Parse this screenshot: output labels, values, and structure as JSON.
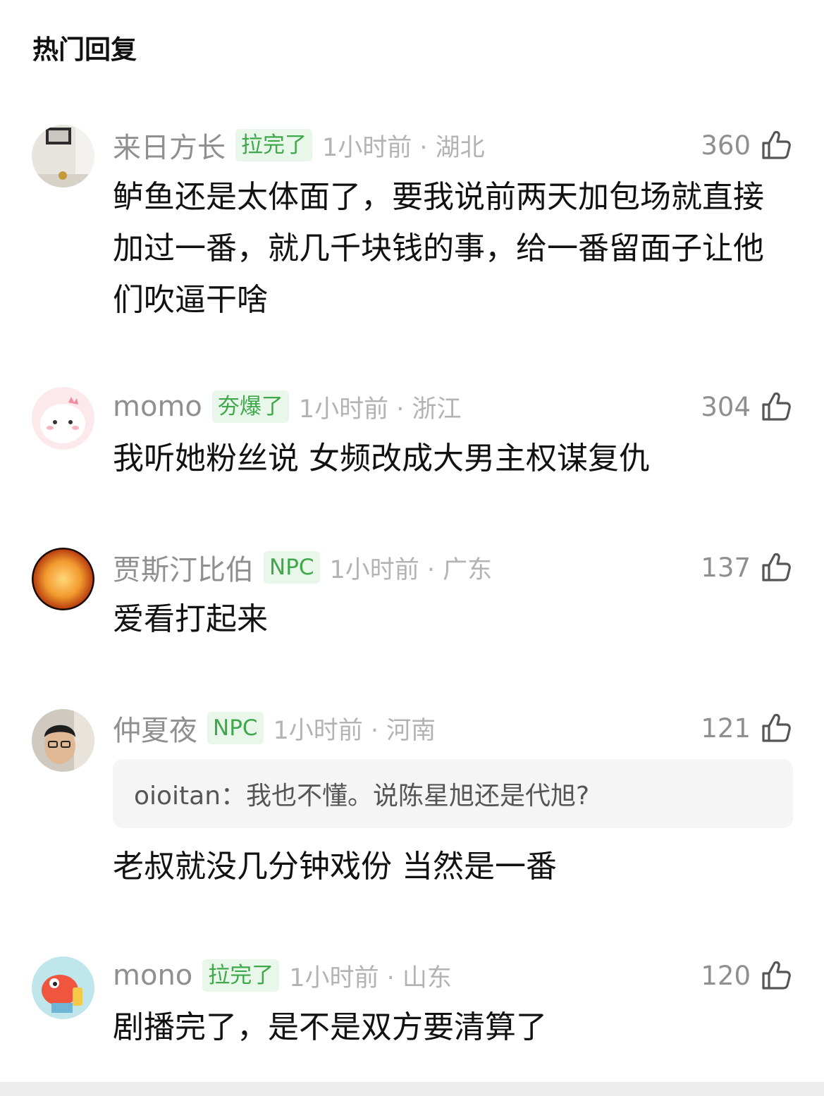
{
  "header": {
    "title": "热门回复"
  },
  "comments": [
    {
      "name": "来日方长",
      "badge": "拉完了",
      "time": "1小时前 · 湖北",
      "likes": "360",
      "text": "鲈鱼还是太体面了，要我说前两天加包场就直接加过一番，就几千块钱的事，给一番留面子让他们吹逼干啥"
    },
    {
      "name": "momo",
      "badge": "夯爆了",
      "time": "1小时前 · 浙江",
      "likes": "304",
      "text": "我听她粉丝说 女频改成大男主权谋复仇"
    },
    {
      "name": "贾斯汀比伯",
      "badge": "NPC",
      "time": "1小时前 · 广东",
      "likes": "137",
      "text": "爱看打起来"
    },
    {
      "name": "仲夏夜",
      "badge": "NPC",
      "time": "1小时前 · 河南",
      "likes": "121",
      "quote": "oioitan：我也不懂。说陈星旭还是代旭?",
      "text": "老叔就没几分钟戏份  当然是一番"
    },
    {
      "name": "mono",
      "badge": "拉完了",
      "time": "1小时前 · 山东",
      "likes": "120",
      "text": "剧播完了，是不是双方要清算了"
    }
  ],
  "icons": {
    "like": "thumbs-up-icon"
  },
  "colors": {
    "badge_text": "#3ea84a",
    "badge_bg": "#e9f6ea",
    "name": "#8f8f8f",
    "time": "#b3b3b3"
  }
}
